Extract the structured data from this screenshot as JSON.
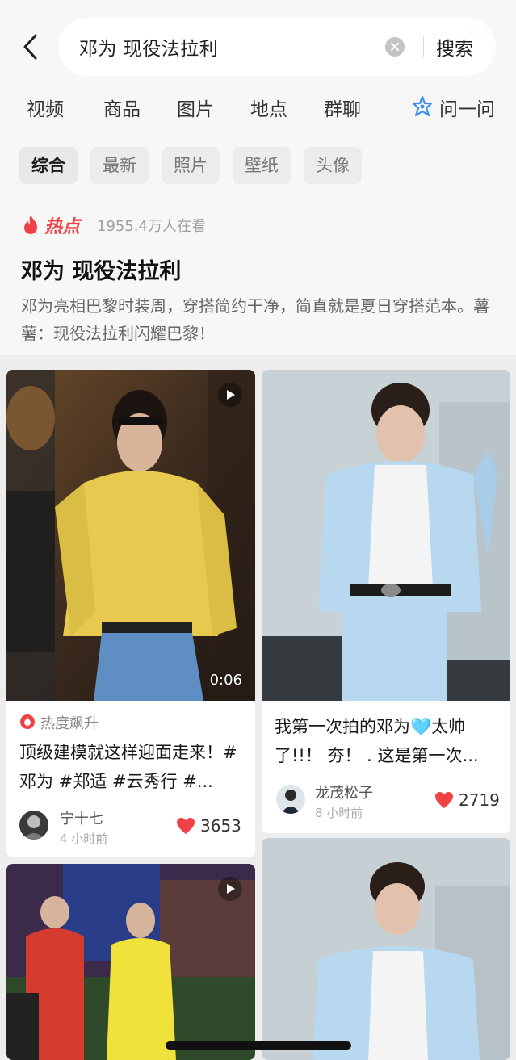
{
  "search": {
    "query": "邓为 现役法拉利",
    "submit_label": "搜索"
  },
  "category_tabs": [
    "视频",
    "商品",
    "图片",
    "地点",
    "群聊"
  ],
  "ask_label": "问一问",
  "filter_chips": [
    "综合",
    "最新",
    "照片",
    "壁纸",
    "头像"
  ],
  "hot": {
    "label": "热点",
    "viewers": "1955.4万人在看",
    "title": "邓为 现役法拉利",
    "description": "邓为亮相巴黎时装周，穿搭简约干净，简直就是夏日穿搭范本。薯薯：现役法拉利闪耀巴黎！"
  },
  "cards": [
    {
      "video_duration": "0:06",
      "trend_label": "热度飙升",
      "title": "顶级建模就这样迎面走来！#邓为 #郑适 #云秀行 #...",
      "author": "宁十七",
      "time": "4 小时前",
      "likes": "3653"
    },
    {
      "title": "我第一次拍的邓为🩵太帅了!!！ 夯！ . 这是第一次...",
      "author": "龙茂松子",
      "time": "8 小时前",
      "likes": "2719"
    }
  ],
  "colors": {
    "accent_red": "#f04246",
    "background": "#ededed",
    "card": "#ffffff"
  }
}
